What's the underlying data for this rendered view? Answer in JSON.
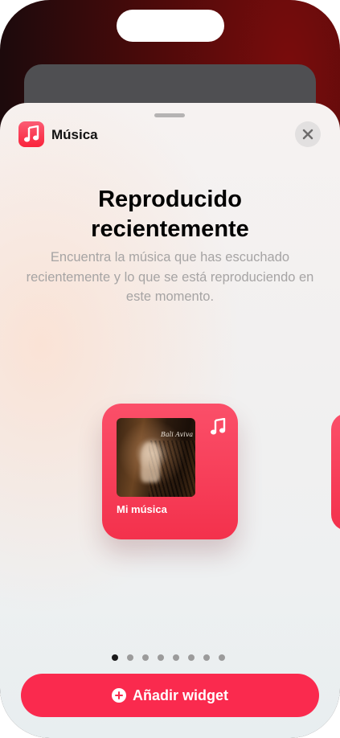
{
  "sheet": {
    "app_name": "Música",
    "title_line1": "Reproducido",
    "title_line2": "recientemente",
    "subtitle": "Encuentra la música que has escuchado recientemente y lo que se está reproduciendo en este momento."
  },
  "widget": {
    "label": "Mi música",
    "accent_color": "#FA2D48"
  },
  "pagination": {
    "total": 8,
    "current": 1
  },
  "actions": {
    "add_widget_label": "Añadir widget"
  },
  "icons": {
    "app": "music-note-icon",
    "close": "close-icon",
    "widget_badge": "music-note-icon",
    "add": "plus-circle-icon"
  }
}
